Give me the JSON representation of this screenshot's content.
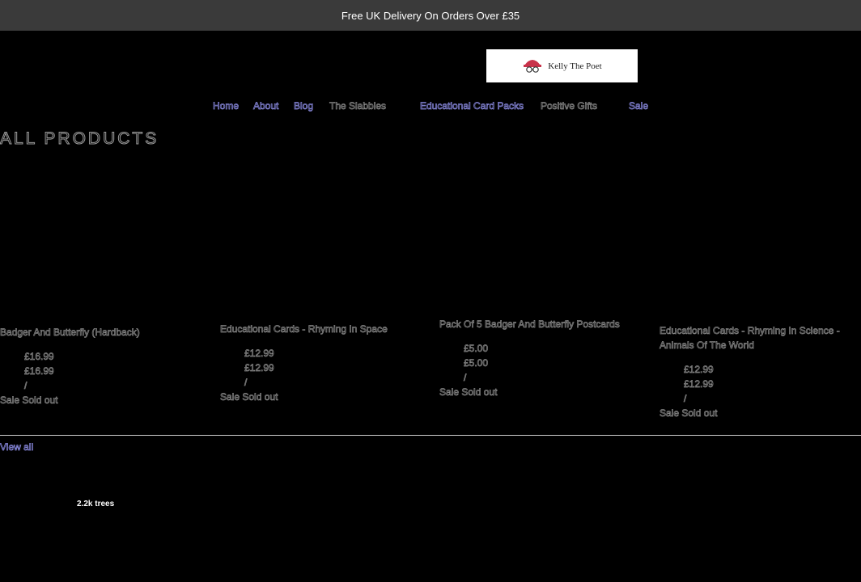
{
  "announcement": "Free UK Delivery On Orders Over £35",
  "logo": {
    "text": "Kelly The Poet"
  },
  "nav": {
    "home": "Home",
    "about": "About",
    "blog": "Blog",
    "slabbies": "The Slabbies",
    "card_packs": "Educational Card Packs",
    "positive_gifts": "Positive Gifts",
    "sale": "Sale"
  },
  "page_title": "ALL PRODUCTS",
  "products": [
    {
      "title": "Badger And Butterfly (Hardback)",
      "price_regular": "£16.99",
      "price_sale": "£16.99",
      "sep": "/",
      "sale": "Sale",
      "sold_out": "Sold out"
    },
    {
      "title": "Educational Cards - Rhyming In Space",
      "price_regular": "£12.99",
      "price_sale": "£12.99",
      "sep": "/",
      "sale": "Sale",
      "sold_out": "Sold out"
    },
    {
      "title": "Pack Of 5 Badger And Butterfly Postcards",
      "price_regular": "£5.00",
      "price_sale": "£5.00",
      "sep": "/",
      "sale": "Sale",
      "sold_out": "Sold out"
    },
    {
      "title": "Educational Cards - Rhyming In Science - Animals Of The World",
      "price_regular": "£12.99",
      "price_sale": "£12.99",
      "sep": "/",
      "sale": "Sale",
      "sold_out": "Sold out"
    }
  ],
  "view_all": "View all",
  "trees": "2.2k trees"
}
